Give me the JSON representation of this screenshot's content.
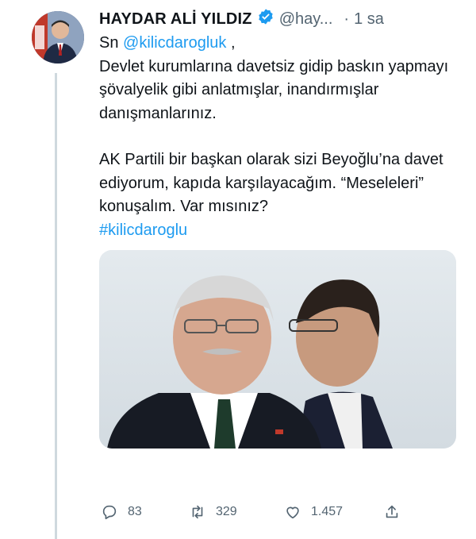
{
  "author": {
    "name": "HAYDAR ALİ YILDIZ",
    "handle": "@hay...",
    "time": "1 sa",
    "separator": "·"
  },
  "more_label": "···",
  "tweet": {
    "prefix": "Sn ",
    "mention": "@kilicdarogluk",
    "mention_suffix": " ,",
    "line_block1": "Devlet kurumlarına davetsiz gidip baskın yapmayı şövalyelik gibi anlatmışlar, inandırmışlar danışmanlarınız.",
    "line_block2": "AK Partili bir başkan olarak sizi Beyoğlu’na davet ediyorum, kapıda karşılayacağım. “Meseleleri” konuşalım. Var mısınız?",
    "hashtag": "#kilicdaroglu"
  },
  "actions": {
    "reply_count": "83",
    "retweet_count": "329",
    "like_count": "1.457"
  },
  "colors": {
    "link": "#1d9bf0",
    "secondary_text": "#536471",
    "verified": "#1d9bf0"
  }
}
